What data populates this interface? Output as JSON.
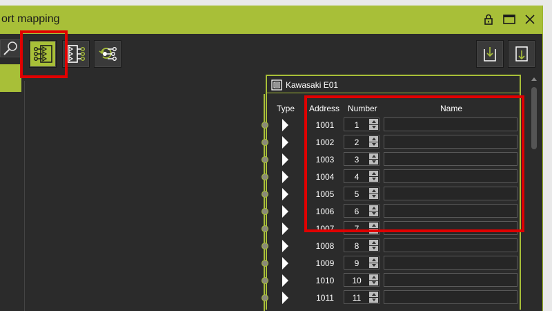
{
  "window": {
    "title": "ort mapping",
    "controls": [
      "lock-icon",
      "maximize-icon",
      "close-icon"
    ]
  },
  "toolbar": {
    "buttons": [
      {
        "name": "input-mapping-icon",
        "active": true
      },
      {
        "name": "output-mapping-icon",
        "active": false
      },
      {
        "name": "signal-mapping-icon",
        "active": false
      }
    ],
    "right_buttons": [
      "import-icon",
      "export-icon"
    ]
  },
  "panel": {
    "title": "Kawasaki E01",
    "icon": "device-icon",
    "columns": {
      "type": "Type",
      "address": "Address",
      "number": "Number",
      "name": "Name"
    },
    "rows": [
      {
        "address": "1001",
        "number": "1",
        "name": ""
      },
      {
        "address": "1002",
        "number": "2",
        "name": ""
      },
      {
        "address": "1003",
        "number": "3",
        "name": ""
      },
      {
        "address": "1004",
        "number": "4",
        "name": ""
      },
      {
        "address": "1005",
        "number": "5",
        "name": ""
      },
      {
        "address": "1006",
        "number": "6",
        "name": ""
      },
      {
        "address": "1007",
        "number": "7",
        "name": ""
      },
      {
        "address": "1008",
        "number": "8",
        "name": ""
      },
      {
        "address": "1009",
        "number": "9",
        "name": ""
      },
      {
        "address": "1010",
        "number": "10",
        "name": ""
      },
      {
        "address": "1011",
        "number": "11",
        "name": ""
      }
    ]
  },
  "colors": {
    "accent": "#a8bf38",
    "background": "#2b2b2b",
    "highlight": "#e00000"
  }
}
